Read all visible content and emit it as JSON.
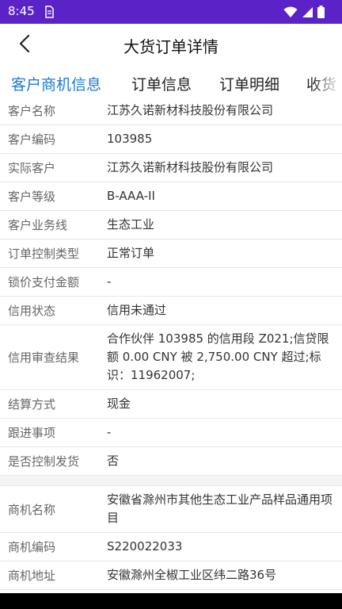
{
  "status_bar": {
    "time": "8:45",
    "icons": [
      "sim-icon",
      "wifi-icon",
      "signal-icon",
      "battery-icon"
    ]
  },
  "header": {
    "title": "大货订单详情",
    "back_icon": "chevron-left-icon"
  },
  "tabs": [
    {
      "label": "客户商机信息",
      "active": true
    },
    {
      "label": "订单信息",
      "active": false
    },
    {
      "label": "订单明细",
      "active": false
    },
    {
      "label": "收货",
      "active": false
    }
  ],
  "customer_section": [
    {
      "label": "客户名称",
      "value": "江苏久诺新材科技股份有限公司"
    },
    {
      "label": "客户编码",
      "value": "103985"
    },
    {
      "label": "实际客户",
      "value": "江苏久诺新材科技股份有限公司"
    },
    {
      "label": "客户等级",
      "value": "B-AAA-II"
    },
    {
      "label": "客户业务线",
      "value": "生态工业"
    },
    {
      "label": "订单控制类型",
      "value": "正常订单"
    },
    {
      "label": "锁价支付金额",
      "value": "-"
    },
    {
      "label": "信用状态",
      "value": "信用未通过"
    },
    {
      "label": "信用审查结果",
      "value": "合作伙伴 103985 的信用段 Z021;信贷限额 0.00 CNY 被 2,750.00 CNY 超过;标识：11962007;"
    },
    {
      "label": "结算方式",
      "value": "现金"
    },
    {
      "label": "跟进事项",
      "value": "-"
    },
    {
      "label": "是否控制发货",
      "value": "否"
    }
  ],
  "opportunity_section": [
    {
      "label": "商机名称",
      "value": "安徽省滁州市其他生态工业产品样品通用项目"
    },
    {
      "label": "商机编码",
      "value": "S220022033"
    },
    {
      "label": "商机地址",
      "value": "安徽滁州全椒工业区纬二路36号"
    }
  ],
  "colors": {
    "status_bar": "#5b23c7",
    "active_tab": "#1f7ad0",
    "label_text": "#666666",
    "value_text": "#333333"
  }
}
